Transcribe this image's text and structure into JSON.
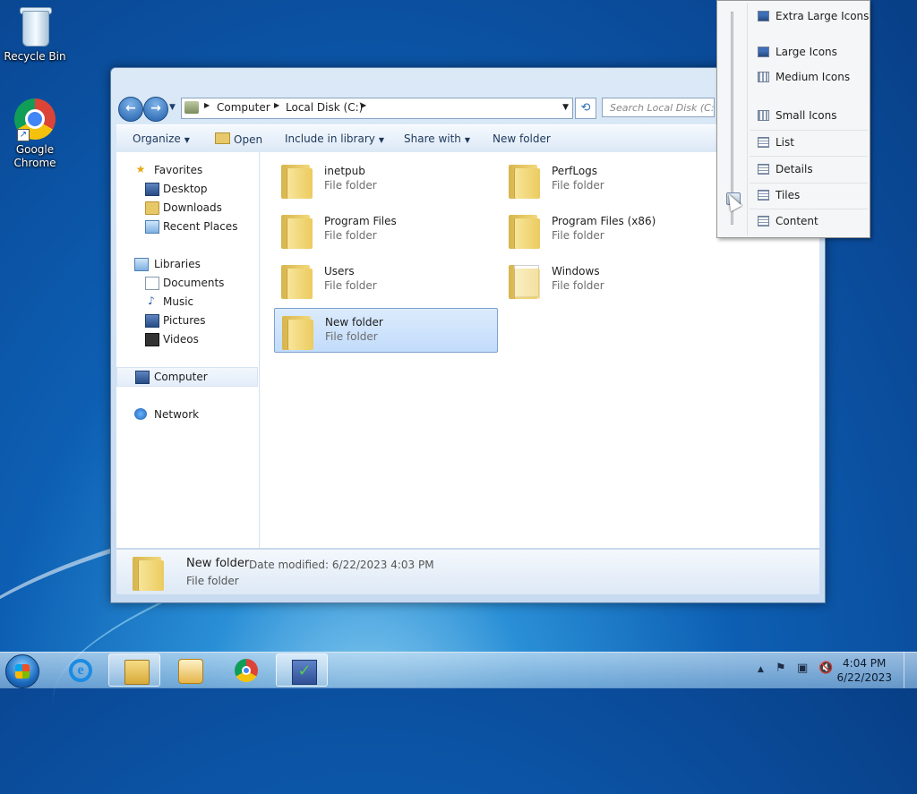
{
  "desktop": {
    "icons": [
      {
        "label": "Recycle Bin"
      },
      {
        "label": "Google Chrome"
      }
    ]
  },
  "explorer": {
    "address": {
      "crumbs": [
        "Computer",
        "Local Disk (C:)"
      ]
    },
    "search": {
      "placeholder": "Search Local Disk (C:)"
    },
    "toolbar": {
      "organize": "Organize",
      "open": "Open",
      "include_in_library": "Include in library",
      "share_with": "Share with",
      "new_folder": "New folder"
    },
    "nav_pane": {
      "favorites": "Favorites",
      "desktop": "Desktop",
      "downloads": "Downloads",
      "recent_places": "Recent Places",
      "libraries": "Libraries",
      "documents": "Documents",
      "music": "Music",
      "pictures": "Pictures",
      "videos": "Videos",
      "computer": "Computer",
      "network": "Network"
    },
    "items": [
      {
        "name": "inetpub",
        "type": "File folder"
      },
      {
        "name": "PerfLogs",
        "type": "File folder"
      },
      {
        "name": "Program Files",
        "type": "File folder"
      },
      {
        "name": "Program Files (x86)",
        "type": "File folder"
      },
      {
        "name": "Users",
        "type": "File folder"
      },
      {
        "name": "Windows",
        "type": "File folder"
      },
      {
        "name": "New folder",
        "type": "File folder",
        "selected": true
      }
    ],
    "details_pane": {
      "name": "New folder",
      "date_label": "Date modified: 6/22/2023 4:03 PM",
      "type": "File folder"
    }
  },
  "view_menu": {
    "items": [
      {
        "label": "Extra Large Icons",
        "icon": "extra-large-icons-icon"
      },
      {
        "label": "Large Icons",
        "icon": "large-icons-icon"
      },
      {
        "label": "Medium Icons",
        "icon": "medium-icons-icon"
      },
      {
        "label": "Small Icons",
        "icon": "small-icons-icon"
      },
      {
        "label": "List",
        "icon": "list-view-icon"
      },
      {
        "label": "Details",
        "icon": "details-view-icon"
      },
      {
        "label": "Tiles",
        "icon": "tiles-view-icon"
      },
      {
        "label": "Content",
        "icon": "content-view-icon"
      }
    ],
    "slider_position": "Tiles"
  },
  "taskbar": {
    "clock_time": "4:04 PM",
    "clock_date": "6/22/2023",
    "apps": [
      "Internet Explorer",
      "Windows Explorer",
      "Windows Media Player",
      "Google Chrome",
      "Task application"
    ]
  },
  "colors": {
    "desktop_blue": "#0d5fb3",
    "selection": "#c2dcfb",
    "window_chrome": "#c7daf0"
  }
}
